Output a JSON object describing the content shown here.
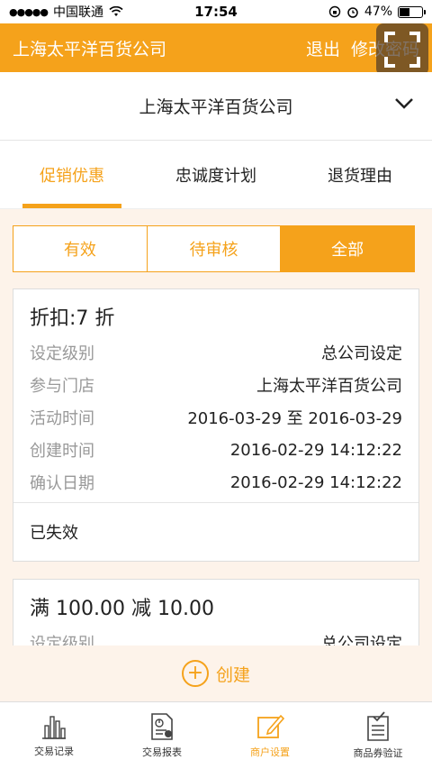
{
  "status_bar": {
    "carrier": "中国联通",
    "time": "17:54",
    "battery": "47%",
    "battery_level": 0.47
  },
  "header": {
    "title": "上海太平洋百货公司",
    "logout_label": "退出",
    "change_password_label": "修改密码"
  },
  "store_select": {
    "value": "上海太平洋百货公司"
  },
  "tabs": [
    {
      "label": "促销优惠",
      "active": true
    },
    {
      "label": "忠诚度计划",
      "active": false
    },
    {
      "label": "退货理由",
      "active": false
    }
  ],
  "filter": [
    {
      "label": "有效",
      "active": false
    },
    {
      "label": "待审核",
      "active": false
    },
    {
      "label": "全部",
      "active": true
    }
  ],
  "promotions": [
    {
      "title": "折扣:7 折",
      "rows": [
        {
          "label": "设定级别",
          "value": "总公司设定"
        },
        {
          "label": "参与门店",
          "value": "上海太平洋百货公司"
        },
        {
          "label": "活动时间",
          "value": "2016-03-29 至 2016-03-29"
        },
        {
          "label": "创建时间",
          "value": "2016-02-29 14:12:22"
        },
        {
          "label": "确认日期",
          "value": "2016-02-29 14:12:22"
        }
      ],
      "status": "已失效"
    },
    {
      "title": "满 100.00 减 10.00",
      "rows": [
        {
          "label": "设定级别",
          "value": "总公司设定"
        }
      ]
    }
  ],
  "create_label": "创建",
  "bottom_nav": [
    {
      "label": "交易记录",
      "icon": "bar-chart-icon",
      "active": false
    },
    {
      "label": "交易报表",
      "icon": "report-icon",
      "active": false
    },
    {
      "label": "商户设置",
      "icon": "edit-icon",
      "active": true
    },
    {
      "label": "商品券验证",
      "icon": "checklist-icon",
      "active": false
    }
  ],
  "colors": {
    "accent": "#f5a21b",
    "background": "#fdf3ea"
  }
}
